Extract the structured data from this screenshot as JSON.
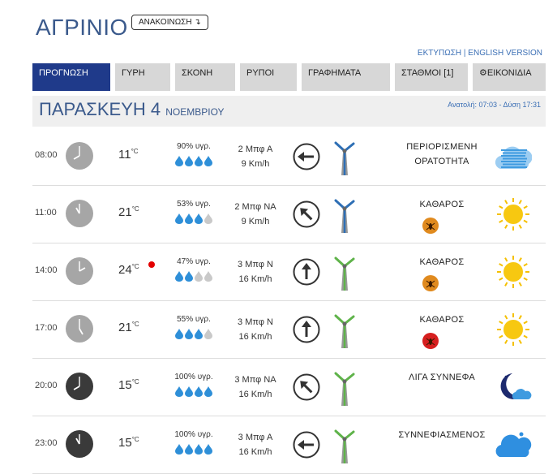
{
  "header": {
    "city": "ΑΓΡΙΝΙΟ",
    "announce_label": "ΑΝΑΚΟΙΝΩΣΗ ↴"
  },
  "links": {
    "print": "ΕΚΤΥΠΩΣΗ",
    "separator": "|",
    "english": "ENGLISH VERSION"
  },
  "tabs": [
    {
      "label": "ΠΡΟΓΝΩΣΗ",
      "active": true
    },
    {
      "label": "ΓΥΡΗ",
      "active": false
    },
    {
      "label": "ΣΚΟΝΗ",
      "active": false
    },
    {
      "label": "ΡΥΠΟΙ",
      "active": false
    },
    {
      "label": "ΓΡΑΦΗΜΑΤΑ",
      "active": false
    },
    {
      "label": "ΣΤΑΘΜΟΙ [1]",
      "active": false
    },
    {
      "label": "⚙ΕΙΚΟΝΙΔΙΑ",
      "active": false
    }
  ],
  "day": {
    "name": "ΠΑΡΑΣΚΕΥΗ 4",
    "month": "ΝΟΕΜΒΡΙΟΥ",
    "sun": "Ανατολή: 07:03 - Δύση 17:31"
  },
  "colors": {
    "accent": "#1f3a8a",
    "title": "#3b5a8c",
    "drop": "#2e8fd8",
    "drop_empty": "#c9c9c9",
    "turbine_blue": "#2e6fb5",
    "turbine_green": "#5fb34a",
    "hot": "#e30000",
    "badge_orange": "#e08a1e",
    "badge_red": "#d61f1f"
  },
  "rows": [
    {
      "time": "08:00",
      "temp": "11",
      "unit": "°C",
      "hum": "90% υγρ.",
      "drops": 4,
      "wind_bf": "2 Μπφ Α",
      "wind_kmh": "9 Km/h",
      "arrow_icon": "arrow-left-icon",
      "turbine": "blue",
      "cond1": "ΠΕΡΙΟΡΙΣΜΕΝΗ",
      "cond2": "ΟΡΑΤΟΤΗΤΑ",
      "badge": null,
      "weather_icon": "fog-icon",
      "clock": "light",
      "clock_hour": 8
    },
    {
      "time": "11:00",
      "temp": "21",
      "unit": "°C",
      "hum": "53% υγρ.",
      "drops": 3,
      "wind_bf": "2 Μπφ ΝΑ",
      "wind_kmh": "9 Km/h",
      "arrow_icon": "arrow-up-left-icon",
      "turbine": "blue",
      "cond1": "ΚΑΘΑΡΟΣ",
      "cond2": "",
      "badge": "orange",
      "weather_icon": "sun-icon",
      "clock": "light",
      "clock_hour": 11
    },
    {
      "time": "14:00",
      "temp": "24",
      "unit": "°C",
      "hum": "47% υγρ.",
      "drops": 2,
      "wind_bf": "3 Μπφ Ν",
      "wind_kmh": "16 Km/h",
      "arrow_icon": "arrow-up-icon",
      "turbine": "green",
      "cond1": "ΚΑΘΑΡΟΣ",
      "cond2": "",
      "badge": "orange",
      "weather_icon": "sun-icon",
      "clock": "light",
      "clock_hour": 2,
      "hot": true
    },
    {
      "time": "17:00",
      "temp": "21",
      "unit": "°C",
      "hum": "55% υγρ.",
      "drops": 3,
      "wind_bf": "3 Μπφ Ν",
      "wind_kmh": "16 Km/h",
      "arrow_icon": "arrow-up-icon",
      "turbine": "green",
      "cond1": "ΚΑΘΑΡΟΣ",
      "cond2": "",
      "badge": "red",
      "weather_icon": "sun-icon",
      "clock": "light",
      "clock_hour": 5
    },
    {
      "time": "20:00",
      "temp": "15",
      "unit": "°C",
      "hum": "100% υγρ.",
      "drops": 4,
      "wind_bf": "3 Μπφ ΝΑ",
      "wind_kmh": "16 Km/h",
      "arrow_icon": "arrow-up-left-icon",
      "turbine": "green",
      "cond1": "ΛΙΓΑ ΣΥΝΝΕΦΑ",
      "cond2": "",
      "badge": null,
      "weather_icon": "moon-cloud-icon",
      "clock": "dark",
      "clock_hour": 8
    },
    {
      "time": "23:00",
      "temp": "15",
      "unit": "°C",
      "hum": "100% υγρ.",
      "drops": 4,
      "wind_bf": "3 Μπφ Α",
      "wind_kmh": "16 Km/h",
      "arrow_icon": "arrow-left-icon",
      "turbine": "green",
      "cond1": "ΣΥΝΝΕΦΙΑΣΜΕΝΟΣ",
      "cond2": "",
      "badge": null,
      "weather_icon": "cloudy-icon",
      "clock": "dark",
      "clock_hour": 11
    }
  ]
}
